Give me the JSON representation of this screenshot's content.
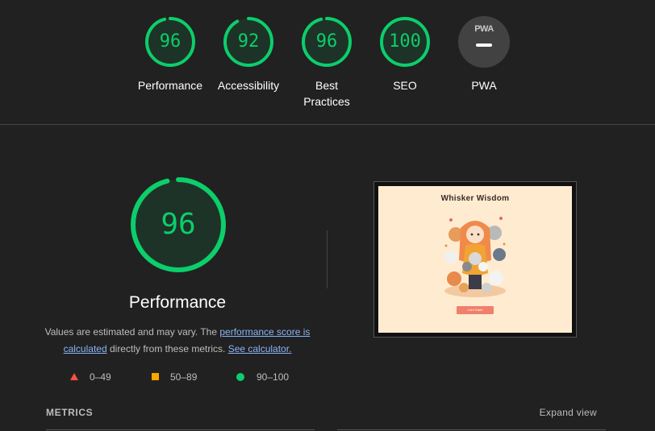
{
  "categories": [
    {
      "label": "Performance",
      "score": "96",
      "progress": 0.96
    },
    {
      "label": "Accessibility",
      "score": "92",
      "progress": 0.92
    },
    {
      "label": "Best Practices",
      "score": "96",
      "progress": 0.96
    },
    {
      "label": "SEO",
      "score": "100",
      "progress": 1.0
    },
    {
      "label": "PWA",
      "badge": "PWA"
    }
  ],
  "performance": {
    "score": "96",
    "progress": 0.96,
    "title": "Performance",
    "desc_prefix": "Values are estimated and may vary. The ",
    "desc_link1": "performance score is calculated",
    "desc_middle": " directly from these metrics. ",
    "desc_link2": "See calculator."
  },
  "legend": {
    "fail": "0–49",
    "average": "50–89",
    "pass": "90–100"
  },
  "screenshot": {
    "site_title": "Whisker Wisdom",
    "button_label": "Let's Start!"
  },
  "metrics": {
    "title": "METRICS",
    "expand_label": "Expand view"
  },
  "colors": {
    "pass": "#0cce6b",
    "average": "#ffa400",
    "fail": "#ff4e42",
    "background": "#212121"
  }
}
